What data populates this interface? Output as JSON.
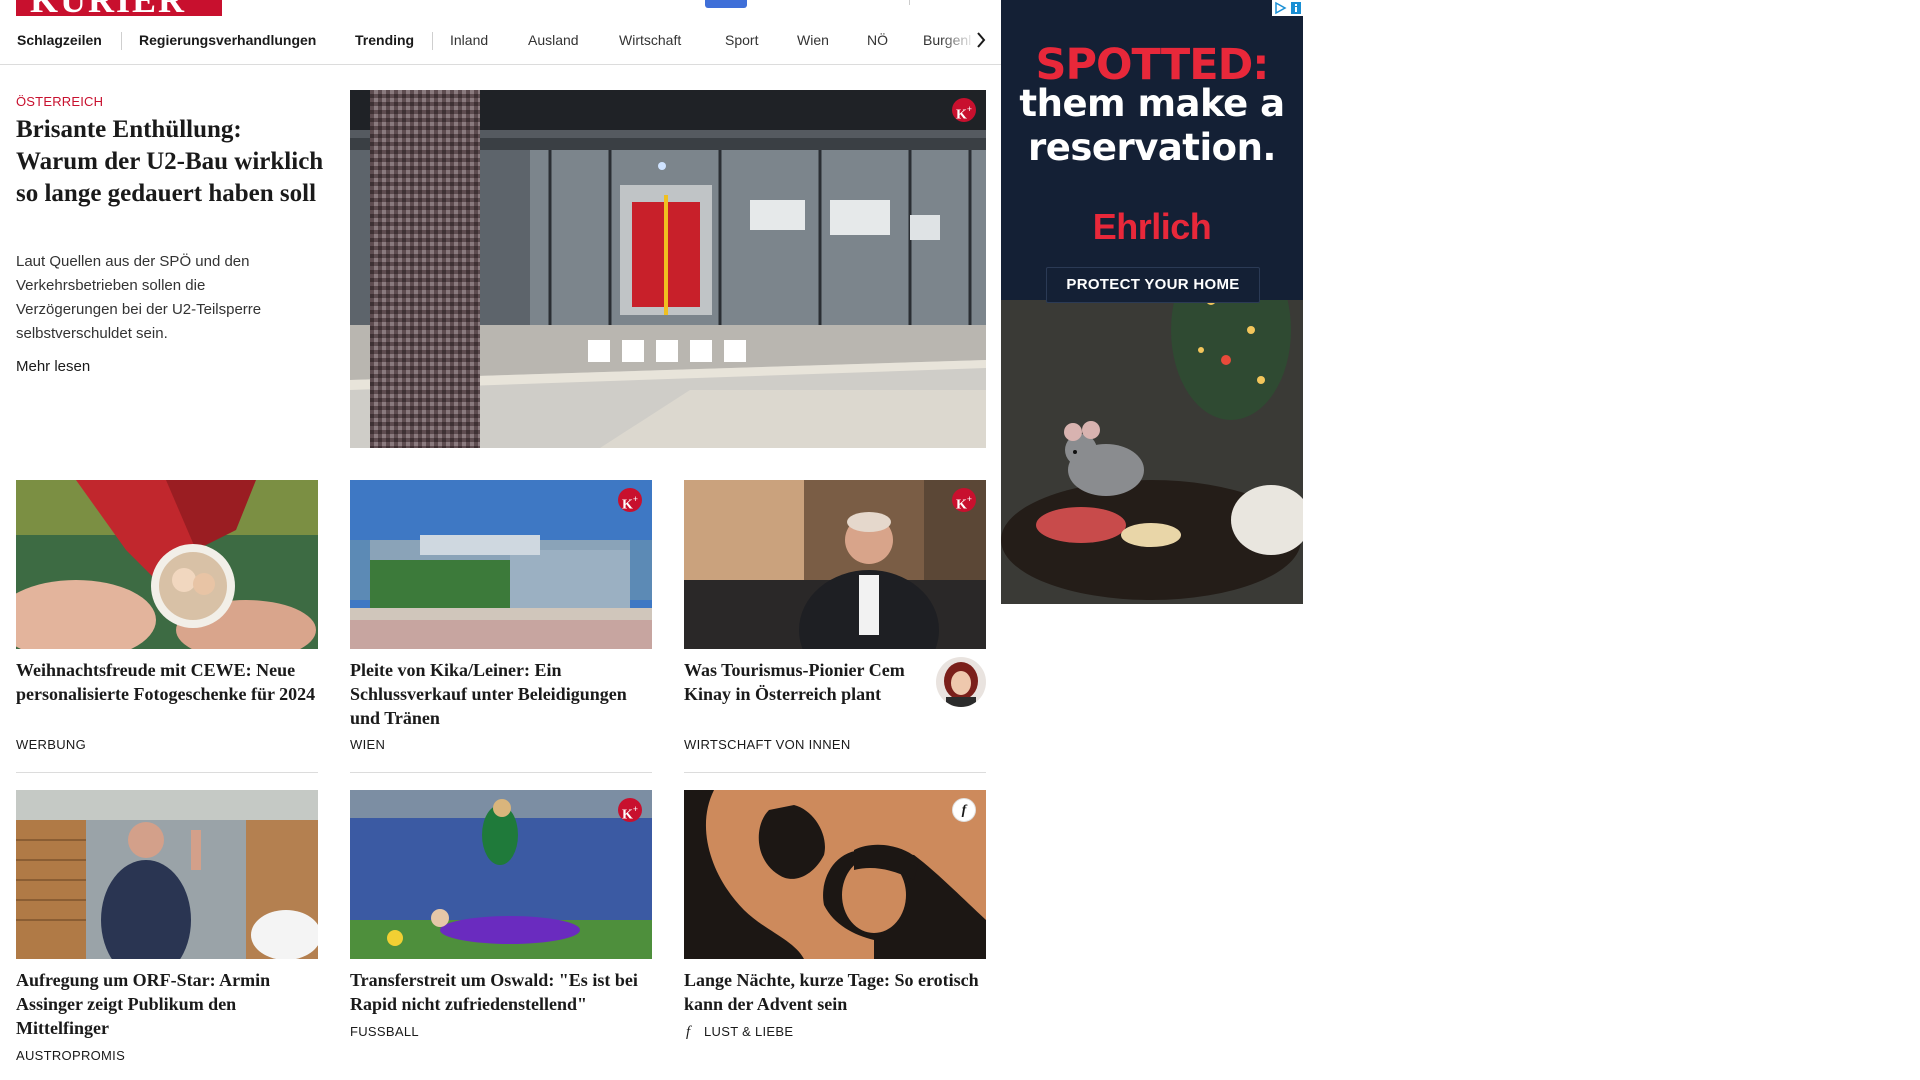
{
  "brand": {
    "logo_text": "KURIER"
  },
  "nav": {
    "items": [
      {
        "label": "Schlagzeilen"
      },
      {
        "label": "Regierungsverhandlungen"
      },
      {
        "label": "Trending"
      },
      {
        "label": "Inland"
      },
      {
        "label": "Ausland"
      },
      {
        "label": "Wirtschaft"
      },
      {
        "label": "Sport"
      },
      {
        "label": "Wien"
      },
      {
        "label": "NÖ"
      },
      {
        "label": "Burgenl"
      }
    ],
    "next_icon": "chevron-right-icon"
  },
  "hero": {
    "kicker": "ÖSTERREICH",
    "title": "Brisante Enthüllung: Warum der U2-Bau wirk­lich so lange gedauert ha­ben soll",
    "teaser": "Laut Quellen aus der SPÖ und den Verkehrsbetrieben sollen die Verzögerungen bei der U2-Teilsperre selbstverschuldet sein.",
    "more": "Mehr lesen",
    "badge": "K+"
  },
  "cards": [
    {
      "title": "Weihnachtsfreude mit CEWE: Neue personalisierte Fotogeschenke für 2024",
      "category": "WERBUNG"
    },
    {
      "title": "Pleite von Kika/Leiner: Ein Schlussverkauf unter Beleidigun­gen und Tränen",
      "category": "WIEN",
      "badge": "K+"
    },
    {
      "title": "Was Tourismus-Pionier Cem Kinay in Österreich plant",
      "category": "WIRTSCHAFT VON INNEN",
      "badge": "K+"
    },
    {
      "title": "Aufregung um ORF-Star: Armin Assinger zeigt Publikum den Mittelfinger",
      "category": "AUSTROPROMIS"
    },
    {
      "title": "Transferstreit um Oswald: \"Es ist bei Rapid nicht zufriedenstellend\"",
      "category": "FUSSBALL",
      "badge": "K+"
    },
    {
      "title": "Lange Nächte, kurze Tage: So ero­tisch kann der Advent sein",
      "category": "LUST & LIEBE",
      "badge": "f"
    }
  ],
  "ad": {
    "headline_1": "SPOTTED:",
    "headline_2": "them make a",
    "headline_3": "reservation.",
    "brand": "Ehrlich",
    "cta": "PROTECT YOUR HOME"
  },
  "colors": {
    "accent": "#c8102e",
    "ad_navy": "#142035",
    "ad_red": "#e8283a"
  }
}
